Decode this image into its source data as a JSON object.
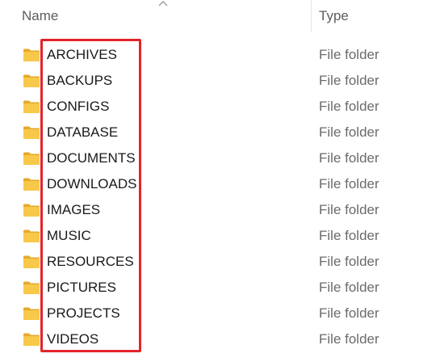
{
  "header": {
    "name_label": "Name",
    "type_label": "Type",
    "sort_icon": "chevron-up-icon"
  },
  "files": [
    {
      "name": "ARCHIVES",
      "type": "File folder",
      "icon": "folder-icon"
    },
    {
      "name": "BACKUPS",
      "type": "File folder",
      "icon": "folder-icon"
    },
    {
      "name": "CONFIGS",
      "type": "File folder",
      "icon": "folder-icon"
    },
    {
      "name": "DATABASE",
      "type": "File folder",
      "icon": "folder-icon"
    },
    {
      "name": "DOCUMENTS",
      "type": "File folder",
      "icon": "folder-icon"
    },
    {
      "name": "DOWNLOADS",
      "type": "File folder",
      "icon": "folder-icon"
    },
    {
      "name": "IMAGES",
      "type": "File folder",
      "icon": "folder-icon"
    },
    {
      "name": "MUSIC",
      "type": "File folder",
      "icon": "folder-icon"
    },
    {
      "name": "RESOURCES",
      "type": "File folder",
      "icon": "folder-icon"
    },
    {
      "name": "PICTURES",
      "type": "File folder",
      "icon": "folder-icon"
    },
    {
      "name": "PROJECTS",
      "type": "File folder",
      "icon": "folder-icon"
    },
    {
      "name": "VIDEOS",
      "type": "File folder",
      "icon": "folder-icon"
    }
  ],
  "colors": {
    "folder_yellow": "#f8c84a",
    "folder_dark": "#e6a928",
    "highlight_red": "#e3242b"
  }
}
